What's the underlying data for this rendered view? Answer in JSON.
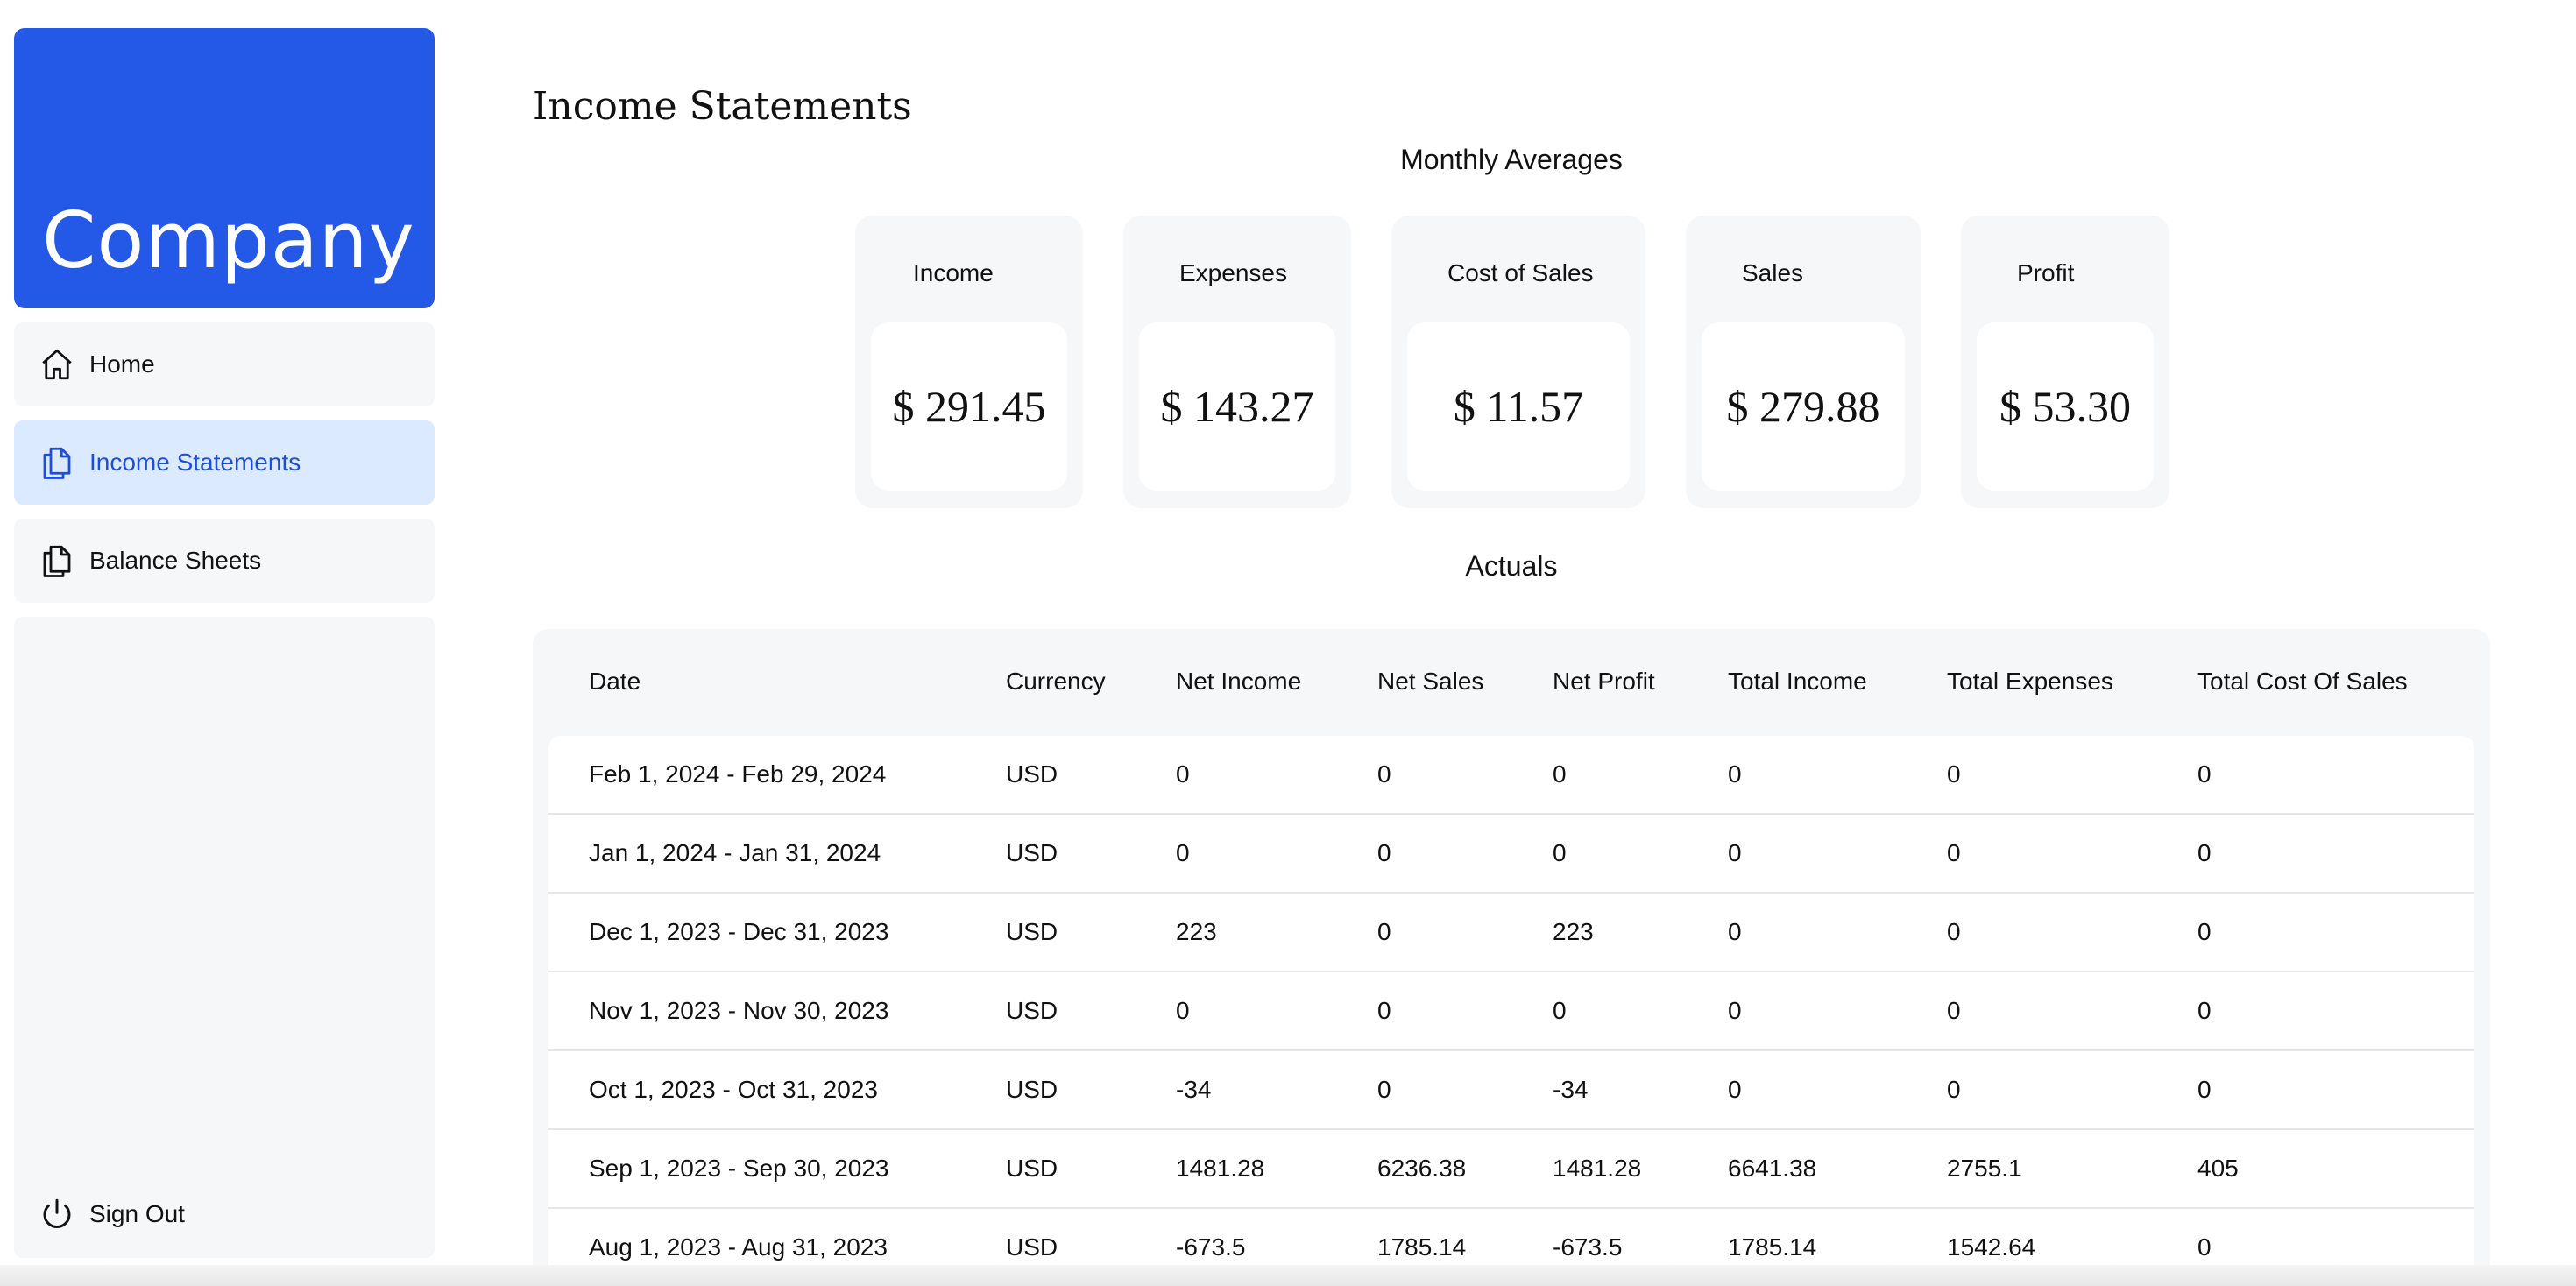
{
  "brand": {
    "name": "Company"
  },
  "sidebar": {
    "items": [
      {
        "label": "Home",
        "icon": "home-icon"
      },
      {
        "label": "Income Statements",
        "icon": "document-icon",
        "active": true
      },
      {
        "label": "Balance Sheets",
        "icon": "document-icon"
      }
    ],
    "signout": {
      "label": "Sign Out",
      "icon": "power-icon"
    }
  },
  "page": {
    "title": "Income Statements"
  },
  "averages": {
    "title": "Monthly Averages",
    "cards": [
      {
        "label": "Income",
        "value": "$ 291.45"
      },
      {
        "label": "Expenses",
        "value": "$ 143.27"
      },
      {
        "label": "Cost of Sales",
        "value": "$ 11.57"
      },
      {
        "label": "Sales",
        "value": "$ 279.88"
      },
      {
        "label": "Profit",
        "value": "$ 53.30"
      }
    ]
  },
  "actuals": {
    "title": "Actuals",
    "columns": [
      "Date",
      "Currency",
      "Net Income",
      "Net Sales",
      "Net Profit",
      "Total Income",
      "Total Expenses",
      "Total Cost Of Sales"
    ],
    "rows": [
      [
        "Feb 1, 2024 - Feb 29, 2024",
        "USD",
        "0",
        "0",
        "0",
        "0",
        "0",
        "0"
      ],
      [
        "Jan 1, 2024 - Jan 31, 2024",
        "USD",
        "0",
        "0",
        "0",
        "0",
        "0",
        "0"
      ],
      [
        "Dec 1, 2023 - Dec 31, 2023",
        "USD",
        "223",
        "0",
        "223",
        "0",
        "0",
        "0"
      ],
      [
        "Nov 1, 2023 - Nov 30, 2023",
        "USD",
        "0",
        "0",
        "0",
        "0",
        "0",
        "0"
      ],
      [
        "Oct 1, 2023 - Oct 31, 2023",
        "USD",
        "-34",
        "0",
        "-34",
        "0",
        "0",
        "0"
      ],
      [
        "Sep 1, 2023 - Sep 30, 2023",
        "USD",
        "1481.28",
        "6236.38",
        "1481.28",
        "6641.38",
        "2755.1",
        "405"
      ],
      [
        "Aug 1, 2023 - Aug 31, 2023",
        "USD",
        "-673.5",
        "1785.14",
        "-673.5",
        "1785.14",
        "1542.64",
        "0"
      ]
    ]
  },
  "colors": {
    "accent": "#2459e8",
    "active_bg": "#dbeafe",
    "active_text": "#1d4ed8",
    "panel": "#f6f7f9"
  }
}
